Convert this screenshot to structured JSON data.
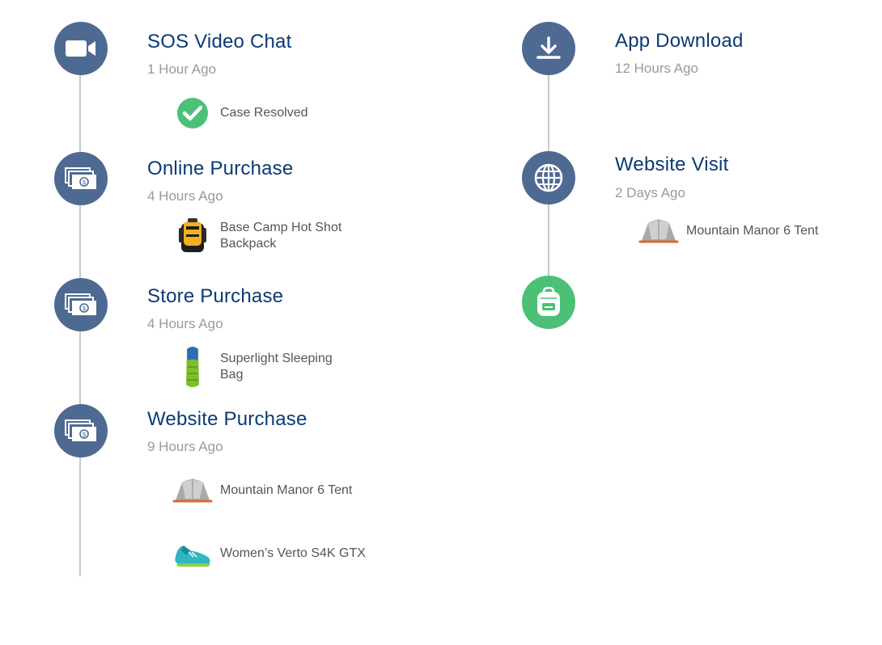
{
  "colors": {
    "node_blue": "#4f6a92",
    "node_green": "#4bc076",
    "title": "#0b3a73",
    "time": "#9a9a9a",
    "line": "#c9c9c9"
  },
  "left": {
    "events": [
      {
        "icon": "video-camera-icon",
        "title": "SOS Video Chat",
        "time": "1 Hour Ago",
        "items": [
          {
            "icon": "check-circle-icon",
            "label": "Case Resolved"
          }
        ]
      },
      {
        "icon": "money-icon",
        "title": "Online Purchase",
        "time": "4 Hours Ago",
        "items": [
          {
            "icon": "backpack-image",
            "label_line1": "Base Camp Hot Shot",
            "label_line2": "Backpack"
          }
        ]
      },
      {
        "icon": "money-icon",
        "title": "Store Purchase",
        "time": "4 Hours Ago",
        "items": [
          {
            "icon": "sleeping-bag-image",
            "label_line1": "Superlight Sleeping",
            "label_line2": "Bag"
          }
        ]
      },
      {
        "icon": "money-icon",
        "title": "Website Purchase",
        "time": "9 Hours Ago",
        "items": [
          {
            "icon": "tent-image",
            "label": "Mountain Manor 6 Tent"
          },
          {
            "icon": "shoe-image",
            "label": "Women’s Verto S4K GTX"
          }
        ]
      }
    ]
  },
  "right": {
    "events": [
      {
        "icon": "download-icon",
        "title": "App Download",
        "time": "12 Hours Ago"
      },
      {
        "icon": "globe-icon",
        "title": "Website Visit",
        "time": "2 Days Ago",
        "items": [
          {
            "icon": "tent-image",
            "label": "Mountain Manor 6 Tent"
          }
        ]
      },
      {
        "icon": "backpack-icon"
      }
    ]
  }
}
